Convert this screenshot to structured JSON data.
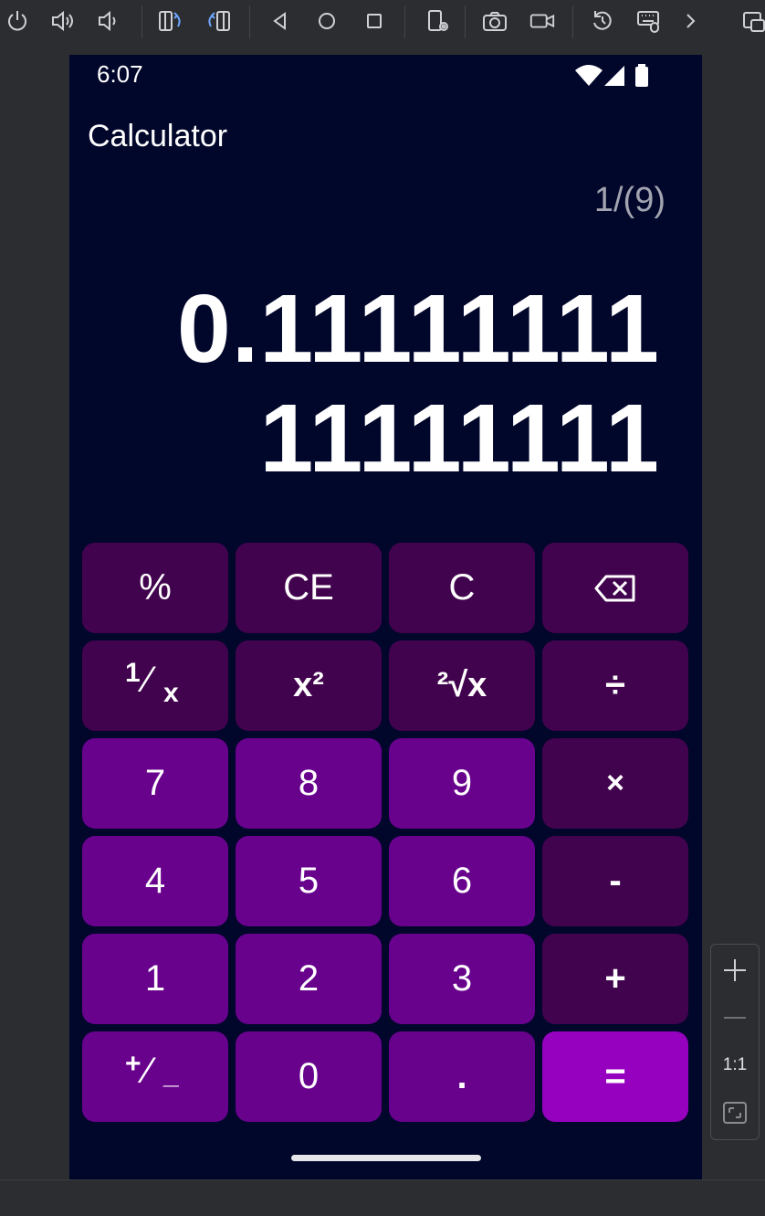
{
  "status_bar": {
    "time": "6:07"
  },
  "app": {
    "title": "Calculator"
  },
  "display": {
    "expression": "1/(9)",
    "result_line1": "0.11111111",
    "result_line2": "11111111"
  },
  "keys": [
    {
      "name": "percent-key",
      "label": "%",
      "style": "fn"
    },
    {
      "name": "clear-entry-key",
      "label": "CE",
      "style": "fn"
    },
    {
      "name": "clear-key",
      "label": "C",
      "style": "fn"
    },
    {
      "name": "backspace-key",
      "label": "",
      "icon": "backspace-icon",
      "style": "fn"
    },
    {
      "name": "reciprocal-key",
      "label": "",
      "sup": "1",
      "sub": "x",
      "style": "fn"
    },
    {
      "name": "square-key",
      "label": "x²",
      "style": "fn"
    },
    {
      "name": "square-root-key",
      "label": "²√x",
      "style": "fn"
    },
    {
      "name": "divide-key",
      "label": "÷",
      "style": "fn"
    },
    {
      "name": "seven-key",
      "label": "7",
      "style": "num"
    },
    {
      "name": "eight-key",
      "label": "8",
      "style": "num"
    },
    {
      "name": "nine-key",
      "label": "9",
      "style": "num"
    },
    {
      "name": "multiply-key",
      "label": "×",
      "style": "fn"
    },
    {
      "name": "four-key",
      "label": "4",
      "style": "num"
    },
    {
      "name": "five-key",
      "label": "5",
      "style": "num"
    },
    {
      "name": "six-key",
      "label": "6",
      "style": "num"
    },
    {
      "name": "minus-key",
      "label": "-",
      "style": "fn"
    },
    {
      "name": "one-key",
      "label": "1",
      "style": "num"
    },
    {
      "name": "two-key",
      "label": "2",
      "style": "num"
    },
    {
      "name": "three-key",
      "label": "3",
      "style": "num"
    },
    {
      "name": "plus-key",
      "label": "+",
      "style": "fn"
    },
    {
      "name": "negate-key",
      "label": "",
      "sup": "+",
      "sub": "_",
      "style": "num"
    },
    {
      "name": "zero-key",
      "label": "0",
      "style": "num"
    },
    {
      "name": "decimal-key",
      "label": ".",
      "style": "num"
    },
    {
      "name": "equals-key",
      "label": "=",
      "style": "eq"
    }
  ],
  "emulator": {
    "zoom_ratio": "1:1"
  },
  "colors": {
    "screen_bg": "#01062b",
    "function_key": "#42034e",
    "number_key": "#68028d",
    "equals_key": "#9601bf",
    "toolbar_bg": "#2b2d30"
  }
}
